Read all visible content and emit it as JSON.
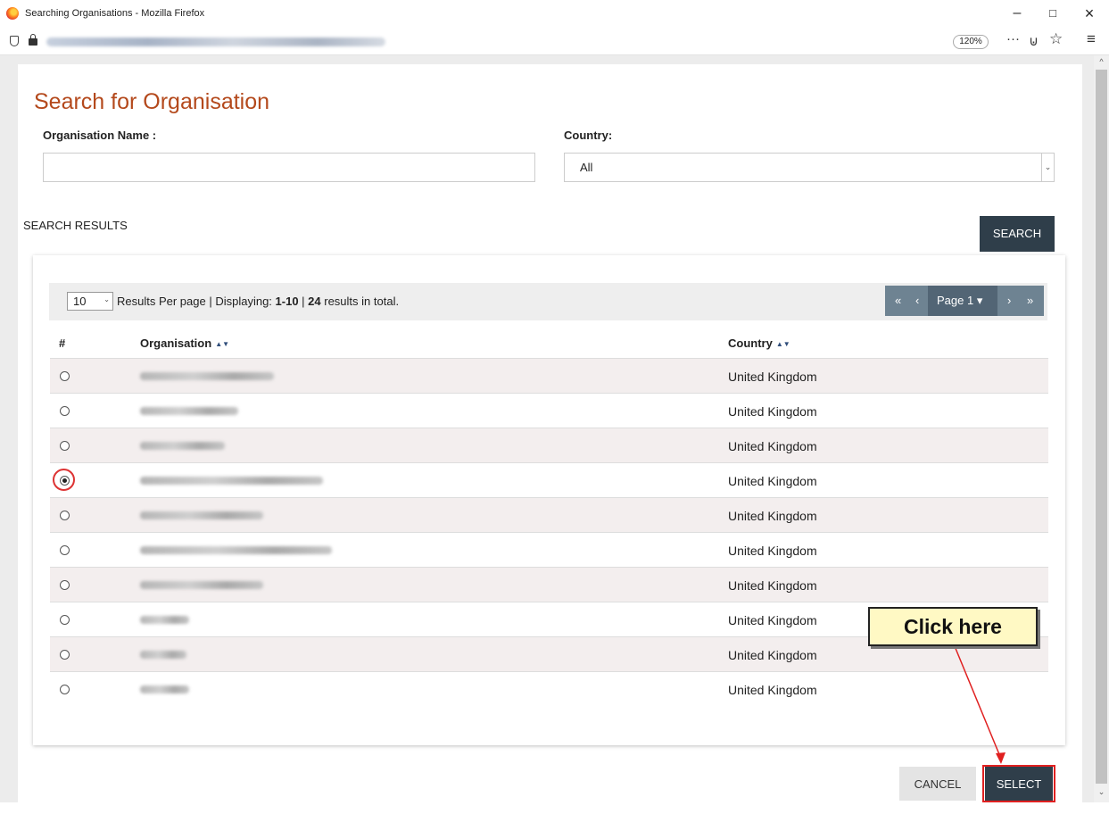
{
  "browser": {
    "window_title": "Searching Organisations - Mozilla Firefox",
    "zoom": "120%",
    "minimize_glyph": "–",
    "maximize_glyph": "□",
    "close_glyph": "×",
    "menu_dots": "···",
    "pocket_glyph": "⊍",
    "star_glyph": "☆",
    "hamburger_glyph": "≡"
  },
  "page": {
    "title": "Search for Organisation",
    "org_name_label": "Organisation Name :",
    "org_name_value": "",
    "country_label": "Country:",
    "country_value": "All",
    "section_label": "SEARCH RESULTS",
    "search_button": "SEARCH",
    "cancel_button": "CANCEL",
    "select_button": "SELECT"
  },
  "results": {
    "per_page": "10",
    "summary_prefix": "Results Per page | Displaying: ",
    "summary_range": "1-10",
    "summary_sep": " | ",
    "summary_total": "24",
    "summary_suffix": " results in total.",
    "pager": {
      "first": "«",
      "prev": "‹",
      "page_label": "Page 1 ▾",
      "next": "›",
      "last": "»"
    },
    "columns": {
      "index": "#",
      "organisation": "Organisation",
      "country": "Country",
      "sort_glyph": "▲▼"
    },
    "rows": [
      {
        "country": "United Kingdom",
        "selected": false
      },
      {
        "country": "United Kingdom",
        "selected": false
      },
      {
        "country": "United Kingdom",
        "selected": false
      },
      {
        "country": "United Kingdom",
        "selected": true
      },
      {
        "country": "United Kingdom",
        "selected": false
      },
      {
        "country": "United Kingdom",
        "selected": false
      },
      {
        "country": "United Kingdom",
        "selected": false
      },
      {
        "country": "United Kingdom",
        "selected": false
      },
      {
        "country": "United Kingdom",
        "selected": false
      },
      {
        "country": "United Kingdom",
        "selected": false
      }
    ]
  },
  "annotation": {
    "callout_text": "Click here",
    "accent_color": "#e02020"
  },
  "colors": {
    "title_orange": "#b4491c",
    "dark_button": "#2f3e4a",
    "pager_bg": "#6e8392",
    "row_alt": "#f3eeee"
  }
}
